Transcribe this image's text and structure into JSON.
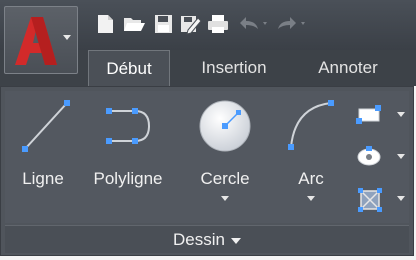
{
  "app": {
    "logo_letter": "A",
    "logo_color": "#d22a2a"
  },
  "quick_access": [
    {
      "name": "new-icon"
    },
    {
      "name": "open-icon"
    },
    {
      "name": "save-icon"
    },
    {
      "name": "save-as-icon"
    },
    {
      "name": "print-icon"
    },
    {
      "name": "undo-icon"
    },
    {
      "name": "redo-icon"
    }
  ],
  "tabs": [
    {
      "label": "Début",
      "active": true
    },
    {
      "label": "Insertion",
      "active": false
    },
    {
      "label": "Annoter",
      "active": false
    }
  ],
  "tools": {
    "line": "Ligne",
    "polyline": "Polyligne",
    "circle": "Cercle",
    "arc": "Arc"
  },
  "panel": {
    "label": "Dessin"
  },
  "colors": {
    "accent_blue": "#4a9bff",
    "dark_chrome": "#3d4248"
  }
}
